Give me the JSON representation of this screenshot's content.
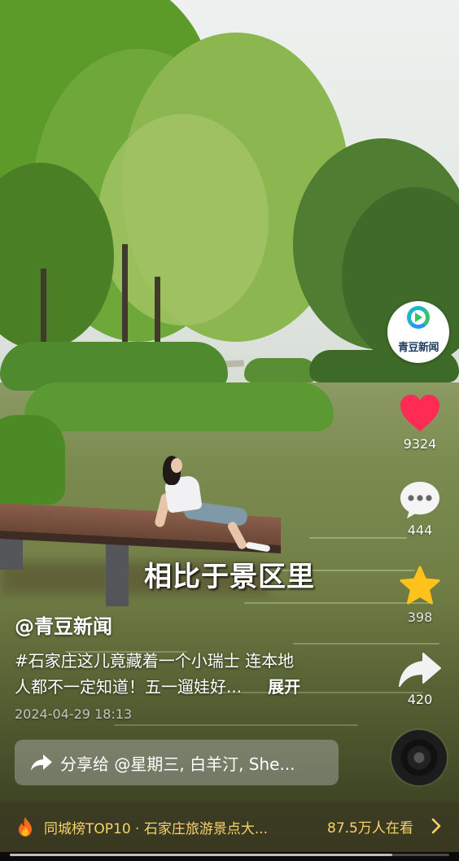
{
  "video": {
    "subtitle": "相比于景区里",
    "author": "@青豆新闻",
    "description_line1": "#石家庄这儿竟藏着一个小瑞士 连本地",
    "description_line2": "人都不一定知道！五一遛娃好...",
    "expand_label": "展开",
    "date": "2024-04-29 18:13",
    "progress": 0.87
  },
  "share": {
    "text": "分享给 @星期三, 白羊汀, She...",
    "icon": "share-arrow-icon"
  },
  "rail": {
    "avatar_label": "青豆新闻",
    "like_count": "9324",
    "comment_count": "444",
    "favorite_count": "398",
    "share_count": "420",
    "like_color": "#fe2c55",
    "favorite_color": "#ffc21b"
  },
  "hot_list": {
    "text": "同城榜TOP10 · 石家庄旅游景点大...",
    "viewers": "87.5万人在看",
    "icon": "flame-icon",
    "accent": "#f7d36a"
  }
}
